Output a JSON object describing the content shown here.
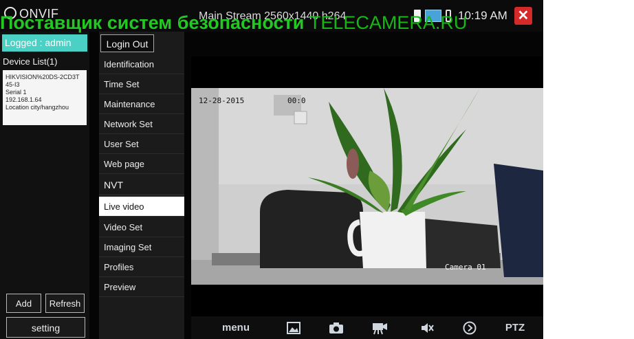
{
  "app": {
    "logo": "ONVIF",
    "stream": "Main Stream 2560x1440 h264",
    "clock": "10:19 AM"
  },
  "watermark": {
    "ru": "Поставщик систем безопасности",
    "en": "TELECAMERA.RU"
  },
  "left": {
    "logged": "Logged : admin",
    "device_list_title": "Device List(1)",
    "device": {
      "name1": "HIKVISION%20DS-2CD3T",
      "name2": "45-I3",
      "serial": "Serial  1",
      "ip": "192.168.1.64",
      "location": "Location  city/hangzhou"
    },
    "add": "Add",
    "refresh": "Refresh",
    "setting": "setting"
  },
  "menu": {
    "login_out": "Login Out",
    "items": [
      "Identification",
      "Time Set",
      "Maintenance",
      "Network Set",
      "User Set",
      "Web page"
    ],
    "section": "NVT",
    "nvt_items": [
      "Live video",
      "Video Set",
      "Imaging Set",
      "Profiles",
      "Preview"
    ],
    "active": "Live video"
  },
  "video": {
    "date": "12-28-2015",
    "time": "00:0",
    "camera": "Camera 01"
  },
  "toolbar": {
    "menu": "menu",
    "ptz": "PTZ"
  },
  "colors": {
    "accent": "#4bd0c6",
    "close": "#d42a2a",
    "watermark": "#22c922"
  }
}
